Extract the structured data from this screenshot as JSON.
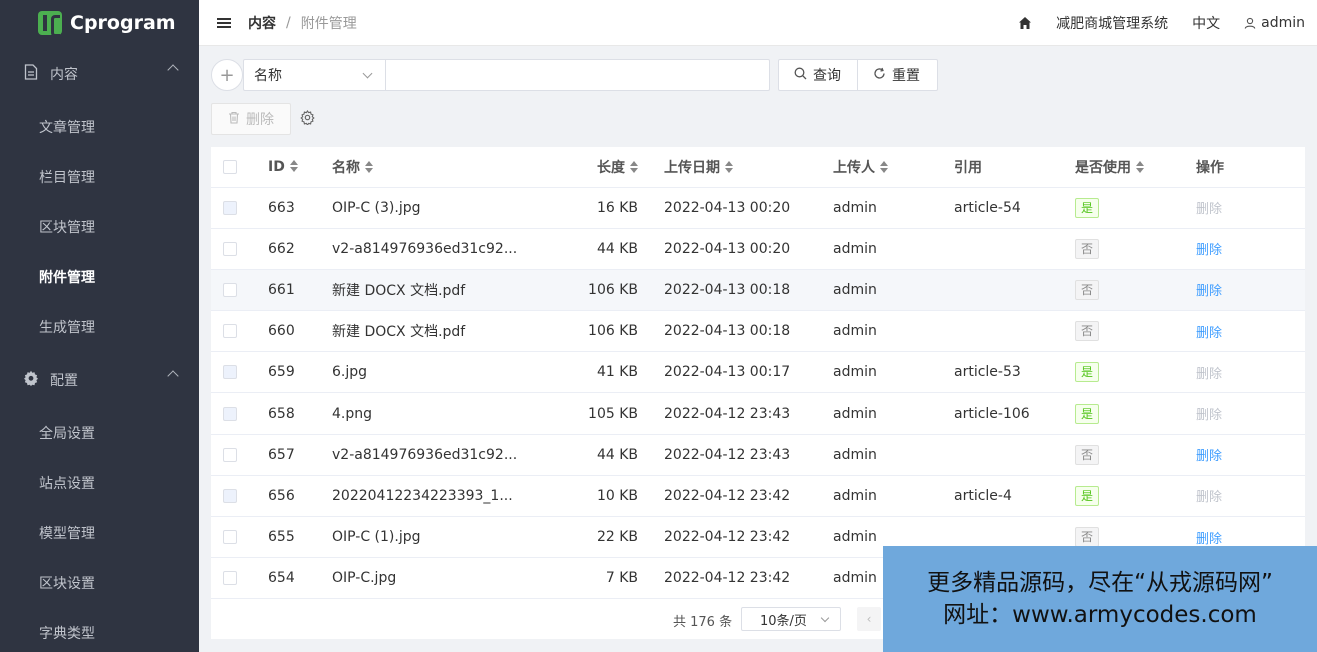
{
  "app": {
    "logo_text": "Cprogram",
    "system_name": "减肥商城管理系统",
    "language": "中文",
    "user": "admin"
  },
  "sidebar": {
    "groups": [
      {
        "label": "内容",
        "icon": "document-icon",
        "items": [
          "文章管理",
          "栏目管理",
          "区块管理",
          "附件管理",
          "生成管理"
        ]
      },
      {
        "label": "配置",
        "icon": "gear-icon",
        "items": [
          "全局设置",
          "站点设置",
          "模型管理",
          "区块设置",
          "字典类型"
        ]
      }
    ],
    "active_item": "附件管理"
  },
  "breadcrumb": {
    "first": "内容",
    "sep": "/",
    "last": "附件管理"
  },
  "search": {
    "field": "名称",
    "value": "",
    "query_label": "查询",
    "reset_label": "重置"
  },
  "toolbar": {
    "delete_label": "删除"
  },
  "table": {
    "columns": [
      "ID",
      "名称",
      "长度",
      "上传日期",
      "上传人",
      "引用",
      "是否使用",
      "操作"
    ],
    "rows": [
      {
        "id": "663",
        "name": "OIP-C (3).jpg",
        "size": "16 KB",
        "date": "2022-04-13 00:20",
        "uploader": "admin",
        "ref": "article-54",
        "used": "是",
        "op": "删除"
      },
      {
        "id": "662",
        "name": "v2-a814976936ed31c92...",
        "size": "44 KB",
        "date": "2022-04-13 00:20",
        "uploader": "admin",
        "ref": "",
        "used": "否",
        "op": "删除"
      },
      {
        "id": "661",
        "name": "新建 DOCX 文档.pdf",
        "size": "106 KB",
        "date": "2022-04-13 00:18",
        "uploader": "admin",
        "ref": "",
        "used": "否",
        "op": "删除"
      },
      {
        "id": "660",
        "name": "新建 DOCX 文档.pdf",
        "size": "106 KB",
        "date": "2022-04-13 00:18",
        "uploader": "admin",
        "ref": "",
        "used": "否",
        "op": "删除"
      },
      {
        "id": "659",
        "name": "6.jpg",
        "size": "41 KB",
        "date": "2022-04-13 00:17",
        "uploader": "admin",
        "ref": "article-53",
        "used": "是",
        "op": "删除"
      },
      {
        "id": "658",
        "name": "4.png",
        "size": "105 KB",
        "date": "2022-04-12 23:43",
        "uploader": "admin",
        "ref": "article-106",
        "used": "是",
        "op": "删除"
      },
      {
        "id": "657",
        "name": "v2-a814976936ed31c92...",
        "size": "44 KB",
        "date": "2022-04-12 23:43",
        "uploader": "admin",
        "ref": "",
        "used": "否",
        "op": "删除"
      },
      {
        "id": "656",
        "name": "20220412234223393_1...",
        "size": "10 KB",
        "date": "2022-04-12 23:42",
        "uploader": "admin",
        "ref": "article-4",
        "used": "是",
        "op": "删除"
      },
      {
        "id": "655",
        "name": "OIP-C (1).jpg",
        "size": "22 KB",
        "date": "2022-04-12 23:42",
        "uploader": "admin",
        "ref": "",
        "used": "否",
        "op": "删除"
      },
      {
        "id": "654",
        "name": "OIP-C.jpg",
        "size": "7 KB",
        "date": "2022-04-12 23:42",
        "uploader": "admin",
        "ref": "",
        "used": "",
        "op": ""
      }
    ]
  },
  "pager": {
    "total": "共 176 条",
    "page_size": "10条/页"
  },
  "watermark": {
    "line1": "更多精品源码，尽在“从戎源码网”",
    "line2": "网址：www.armycodes.com"
  },
  "colors": {
    "sidebar_bg": "#2f3441",
    "link": "#409eff",
    "tag_yes": "#52c41a",
    "watermark_bg": "#6fa8dc"
  }
}
